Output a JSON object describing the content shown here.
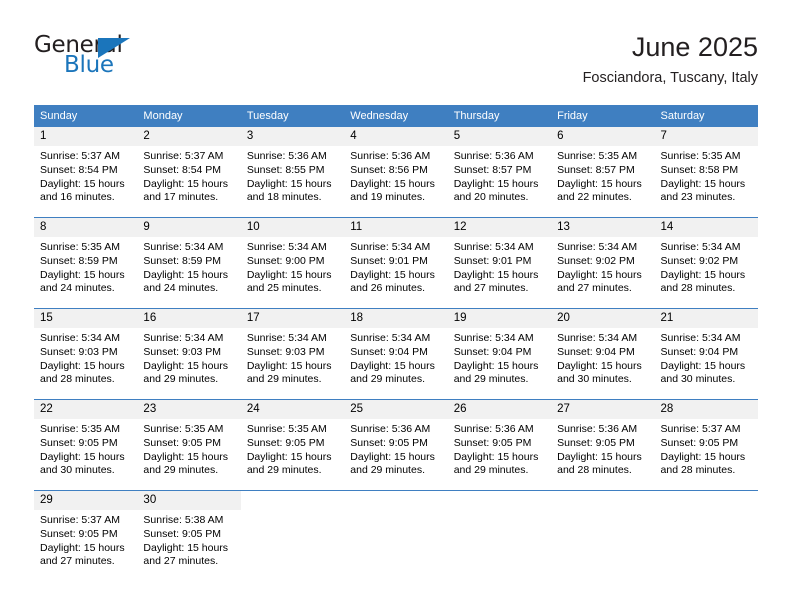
{
  "brand": {
    "name_part1": "General",
    "name_part2": "Blue",
    "triangle_icon": "triangle-logo-icon",
    "accent_color": "#1b75bb"
  },
  "header": {
    "title": "June 2025",
    "location": "Fosciandora, Tuscany, Italy"
  },
  "colors": {
    "header_blue": "#3f7fc1",
    "daynum_bg": "#f1f1f1",
    "text": "#000000"
  },
  "weekday_headers": [
    "Sunday",
    "Monday",
    "Tuesday",
    "Wednesday",
    "Thursday",
    "Friday",
    "Saturday"
  ],
  "weeks": [
    [
      {
        "day": "1",
        "sunrise": "Sunrise: 5:37 AM",
        "sunset": "Sunset: 8:54 PM",
        "daylight1": "Daylight: 15 hours",
        "daylight2": "and 16 minutes."
      },
      {
        "day": "2",
        "sunrise": "Sunrise: 5:37 AM",
        "sunset": "Sunset: 8:54 PM",
        "daylight1": "Daylight: 15 hours",
        "daylight2": "and 17 minutes."
      },
      {
        "day": "3",
        "sunrise": "Sunrise: 5:36 AM",
        "sunset": "Sunset: 8:55 PM",
        "daylight1": "Daylight: 15 hours",
        "daylight2": "and 18 minutes."
      },
      {
        "day": "4",
        "sunrise": "Sunrise: 5:36 AM",
        "sunset": "Sunset: 8:56 PM",
        "daylight1": "Daylight: 15 hours",
        "daylight2": "and 19 minutes."
      },
      {
        "day": "5",
        "sunrise": "Sunrise: 5:36 AM",
        "sunset": "Sunset: 8:57 PM",
        "daylight1": "Daylight: 15 hours",
        "daylight2": "and 20 minutes."
      },
      {
        "day": "6",
        "sunrise": "Sunrise: 5:35 AM",
        "sunset": "Sunset: 8:57 PM",
        "daylight1": "Daylight: 15 hours",
        "daylight2": "and 22 minutes."
      },
      {
        "day": "7",
        "sunrise": "Sunrise: 5:35 AM",
        "sunset": "Sunset: 8:58 PM",
        "daylight1": "Daylight: 15 hours",
        "daylight2": "and 23 minutes."
      }
    ],
    [
      {
        "day": "8",
        "sunrise": "Sunrise: 5:35 AM",
        "sunset": "Sunset: 8:59 PM",
        "daylight1": "Daylight: 15 hours",
        "daylight2": "and 24 minutes."
      },
      {
        "day": "9",
        "sunrise": "Sunrise: 5:34 AM",
        "sunset": "Sunset: 8:59 PM",
        "daylight1": "Daylight: 15 hours",
        "daylight2": "and 24 minutes."
      },
      {
        "day": "10",
        "sunrise": "Sunrise: 5:34 AM",
        "sunset": "Sunset: 9:00 PM",
        "daylight1": "Daylight: 15 hours",
        "daylight2": "and 25 minutes."
      },
      {
        "day": "11",
        "sunrise": "Sunrise: 5:34 AM",
        "sunset": "Sunset: 9:01 PM",
        "daylight1": "Daylight: 15 hours",
        "daylight2": "and 26 minutes."
      },
      {
        "day": "12",
        "sunrise": "Sunrise: 5:34 AM",
        "sunset": "Sunset: 9:01 PM",
        "daylight1": "Daylight: 15 hours",
        "daylight2": "and 27 minutes."
      },
      {
        "day": "13",
        "sunrise": "Sunrise: 5:34 AM",
        "sunset": "Sunset: 9:02 PM",
        "daylight1": "Daylight: 15 hours",
        "daylight2": "and 27 minutes."
      },
      {
        "day": "14",
        "sunrise": "Sunrise: 5:34 AM",
        "sunset": "Sunset: 9:02 PM",
        "daylight1": "Daylight: 15 hours",
        "daylight2": "and 28 minutes."
      }
    ],
    [
      {
        "day": "15",
        "sunrise": "Sunrise: 5:34 AM",
        "sunset": "Sunset: 9:03 PM",
        "daylight1": "Daylight: 15 hours",
        "daylight2": "and 28 minutes."
      },
      {
        "day": "16",
        "sunrise": "Sunrise: 5:34 AM",
        "sunset": "Sunset: 9:03 PM",
        "daylight1": "Daylight: 15 hours",
        "daylight2": "and 29 minutes."
      },
      {
        "day": "17",
        "sunrise": "Sunrise: 5:34 AM",
        "sunset": "Sunset: 9:03 PM",
        "daylight1": "Daylight: 15 hours",
        "daylight2": "and 29 minutes."
      },
      {
        "day": "18",
        "sunrise": "Sunrise: 5:34 AM",
        "sunset": "Sunset: 9:04 PM",
        "daylight1": "Daylight: 15 hours",
        "daylight2": "and 29 minutes."
      },
      {
        "day": "19",
        "sunrise": "Sunrise: 5:34 AM",
        "sunset": "Sunset: 9:04 PM",
        "daylight1": "Daylight: 15 hours",
        "daylight2": "and 29 minutes."
      },
      {
        "day": "20",
        "sunrise": "Sunrise: 5:34 AM",
        "sunset": "Sunset: 9:04 PM",
        "daylight1": "Daylight: 15 hours",
        "daylight2": "and 30 minutes."
      },
      {
        "day": "21",
        "sunrise": "Sunrise: 5:34 AM",
        "sunset": "Sunset: 9:04 PM",
        "daylight1": "Daylight: 15 hours",
        "daylight2": "and 30 minutes."
      }
    ],
    [
      {
        "day": "22",
        "sunrise": "Sunrise: 5:35 AM",
        "sunset": "Sunset: 9:05 PM",
        "daylight1": "Daylight: 15 hours",
        "daylight2": "and 30 minutes."
      },
      {
        "day": "23",
        "sunrise": "Sunrise: 5:35 AM",
        "sunset": "Sunset: 9:05 PM",
        "daylight1": "Daylight: 15 hours",
        "daylight2": "and 29 minutes."
      },
      {
        "day": "24",
        "sunrise": "Sunrise: 5:35 AM",
        "sunset": "Sunset: 9:05 PM",
        "daylight1": "Daylight: 15 hours",
        "daylight2": "and 29 minutes."
      },
      {
        "day": "25",
        "sunrise": "Sunrise: 5:36 AM",
        "sunset": "Sunset: 9:05 PM",
        "daylight1": "Daylight: 15 hours",
        "daylight2": "and 29 minutes."
      },
      {
        "day": "26",
        "sunrise": "Sunrise: 5:36 AM",
        "sunset": "Sunset: 9:05 PM",
        "daylight1": "Daylight: 15 hours",
        "daylight2": "and 29 minutes."
      },
      {
        "day": "27",
        "sunrise": "Sunrise: 5:36 AM",
        "sunset": "Sunset: 9:05 PM",
        "daylight1": "Daylight: 15 hours",
        "daylight2": "and 28 minutes."
      },
      {
        "day": "28",
        "sunrise": "Sunrise: 5:37 AM",
        "sunset": "Sunset: 9:05 PM",
        "daylight1": "Daylight: 15 hours",
        "daylight2": "and 28 minutes."
      }
    ],
    [
      {
        "day": "29",
        "sunrise": "Sunrise: 5:37 AM",
        "sunset": "Sunset: 9:05 PM",
        "daylight1": "Daylight: 15 hours",
        "daylight2": "and 27 minutes."
      },
      {
        "day": "30",
        "sunrise": "Sunrise: 5:38 AM",
        "sunset": "Sunset: 9:05 PM",
        "daylight1": "Daylight: 15 hours",
        "daylight2": "and 27 minutes."
      },
      {
        "day": "",
        "sunrise": "",
        "sunset": "",
        "daylight1": "",
        "daylight2": ""
      },
      {
        "day": "",
        "sunrise": "",
        "sunset": "",
        "daylight1": "",
        "daylight2": ""
      },
      {
        "day": "",
        "sunrise": "",
        "sunset": "",
        "daylight1": "",
        "daylight2": ""
      },
      {
        "day": "",
        "sunrise": "",
        "sunset": "",
        "daylight1": "",
        "daylight2": ""
      },
      {
        "day": "",
        "sunrise": "",
        "sunset": "",
        "daylight1": "",
        "daylight2": ""
      }
    ]
  ]
}
